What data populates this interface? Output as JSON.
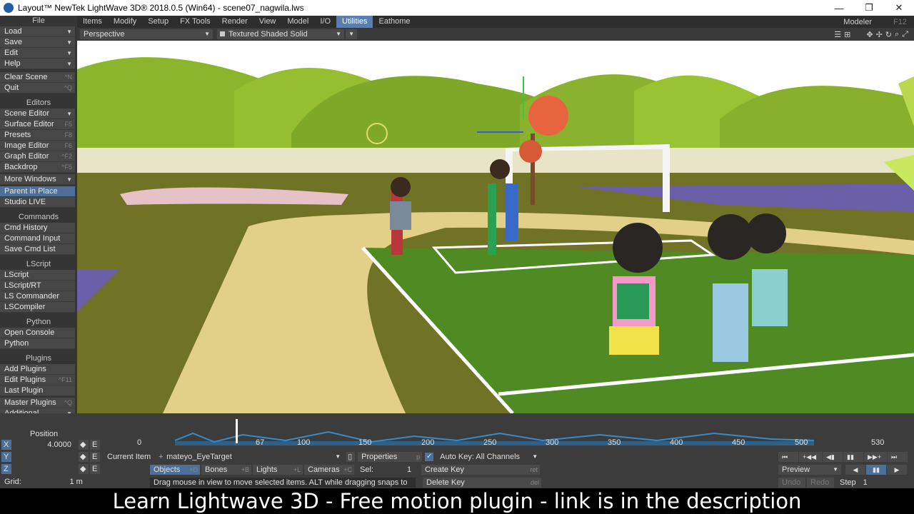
{
  "window": {
    "title": "Layout™ NewTek LightWave 3D® 2018.0.5 (Win64) - scene07_nagwila.lws",
    "min": "—",
    "max": "❐",
    "close": "✕"
  },
  "menu": {
    "tabs": [
      "Items",
      "Modify",
      "Setup",
      "FX Tools",
      "Render",
      "View",
      "Model",
      "I/O",
      "Utilities",
      "Eathome"
    ],
    "active_tab": "Utilities",
    "modeler_label": "Modeler",
    "modeler_key": "F12"
  },
  "sidebar": {
    "file_header": "File",
    "file_items": [
      {
        "label": "Load",
        "arrow": "▼"
      },
      {
        "label": "Save",
        "arrow": "▼"
      },
      {
        "label": "Edit",
        "arrow": "▼"
      },
      {
        "label": "Help",
        "arrow": "▼"
      }
    ],
    "clear_scene": {
      "label": "Clear Scene",
      "key": "^N"
    },
    "quit": {
      "label": "Quit",
      "key": "^Q"
    },
    "editors_header": "Editors",
    "editors": [
      {
        "label": "Scene Editor",
        "key": "▼"
      },
      {
        "label": "Surface Editor",
        "key": "F5"
      },
      {
        "label": "Presets",
        "key": "F8"
      },
      {
        "label": "Image Editor",
        "key": "F6"
      },
      {
        "label": "Graph Editor",
        "key": "^F2"
      },
      {
        "label": "Backdrop",
        "key": "^F5"
      }
    ],
    "more_windows": "More Windows",
    "parent_in_place": "Parent in Place",
    "studio_live": "Studio LIVE",
    "commands_header": "Commands",
    "commands": [
      "Cmd History",
      "Command Input",
      "Save Cmd List"
    ],
    "lscript_header": "LScript",
    "lscript": [
      "LScript",
      "LScript/RT",
      "LS Commander",
      "LSCompiler"
    ],
    "python_header": "Python",
    "python": [
      "Open Console",
      "Python"
    ],
    "plugins_header": "Plugins",
    "plugins": [
      {
        "label": "Add Plugins",
        "key": ""
      },
      {
        "label": "Edit Plugins",
        "key": "^F11"
      },
      {
        "label": "Last Plugin",
        "key": ""
      }
    ],
    "master_plugins": {
      "label": "Master Plugins",
      "key": "^Q"
    },
    "additional": "Additional"
  },
  "viewport_bar": {
    "view_mode": "Perspective",
    "shading_mode": "Textured Shaded Solid"
  },
  "timeline": {
    "position_label": "Position",
    "axes": [
      "X",
      "Y",
      "Z"
    ],
    "x_value": "4.0000",
    "ruler_ticks": [
      "0",
      "67",
      "100",
      "150",
      "200",
      "250",
      "300",
      "350",
      "400",
      "450",
      "500",
      "530"
    ],
    "current_frame": "67",
    "current_item_label": "Current Item",
    "current_item_value": "mateyo_EyeTarget",
    "properties": {
      "label": "Properties",
      "key": "p"
    },
    "auto_key": "Auto Key: All Channels",
    "objects": {
      "label": "Objects",
      "key": "+O"
    },
    "bones": {
      "label": "Bones",
      "key": "+B"
    },
    "lights": {
      "label": "Lights",
      "key": "+L"
    },
    "cameras": {
      "label": "Cameras",
      "key": "+C"
    },
    "sel_label": "Sel:",
    "sel_value": "1",
    "create_key": {
      "label": "Create Key",
      "key": "ret"
    },
    "delete_key": {
      "label": "Delete Key",
      "key": "del"
    },
    "grid_label": "Grid:",
    "grid_value": "1 m",
    "status_message": "Drag mouse in view to move selected items. ALT while dragging snaps to items.",
    "preview": "Preview",
    "undo": "Undo",
    "redo": "Redo",
    "step_label": "Step",
    "step_value": "1"
  },
  "caption": "Learn Lightwave 3D - Free motion plugin - link is in the description"
}
